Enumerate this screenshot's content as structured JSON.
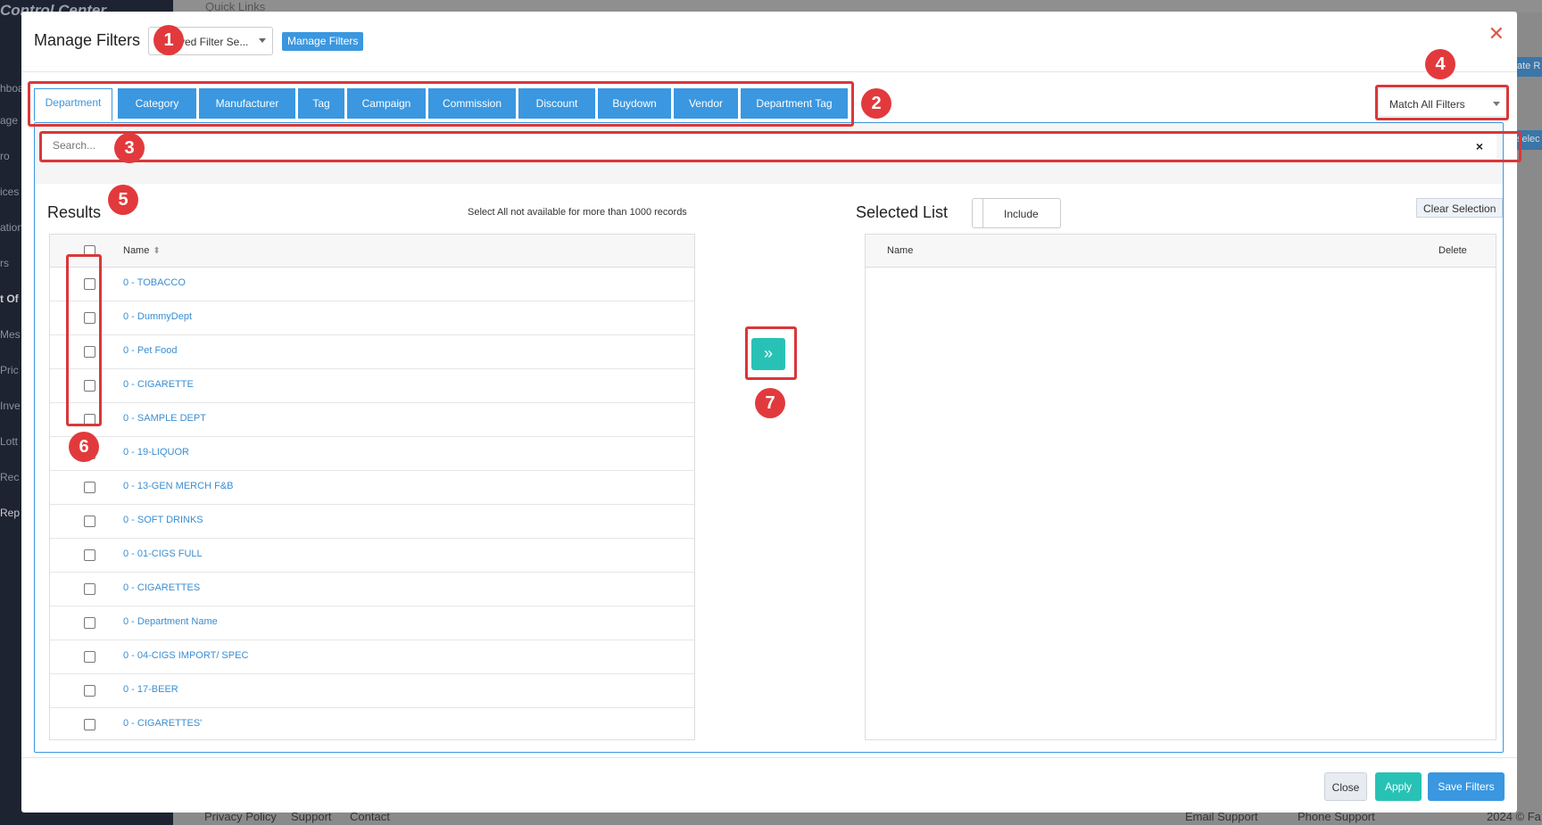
{
  "background": {
    "sidebar_title": "Control Center",
    "sidebar_items": [
      "hboa",
      "age",
      "ro",
      "ices",
      "ation",
      "rs",
      "t Of",
      "Mes",
      "Pric",
      "Inve",
      "Lott",
      "Rec",
      "Rep"
    ],
    "quick_links": "Quick Links",
    "right_buttons": [
      "ate R",
      "selec"
    ],
    "footer_links": [
      "Privacy Policy",
      "Support",
      "Contact"
    ],
    "footer_right": [
      "Email Support",
      "Phone Support",
      "2024 © Fa"
    ]
  },
  "modal": {
    "title": "Manage Filters",
    "saved_filter_select": "ved Filter Se...",
    "manage_filters_button": "Manage Filters",
    "tabs": [
      {
        "label": "Department"
      },
      {
        "label": "Category"
      },
      {
        "label": "Manufacturer"
      },
      {
        "label": "Tag"
      },
      {
        "label": "Campaign"
      },
      {
        "label": "Commission"
      },
      {
        "label": "Discount"
      },
      {
        "label": "Buydown"
      },
      {
        "label": "Vendor"
      },
      {
        "label": "Department Tag"
      }
    ],
    "match_select": "Match All Filters",
    "search": {
      "placeholder": "Search...",
      "clear": "×"
    },
    "results": {
      "title": "Results",
      "note": "Select All not available for more than 1000 records",
      "column_name": "Name",
      "rows": [
        "0 - TOBACCO",
        "0 - DummyDept",
        "0 - Pet Food",
        "0 - CIGARETTE",
        "0 - SAMPLE DEPT",
        "0 - 19-LIQUOR",
        "0 - 13-GEN MERCH F&B",
        "0 - SOFT DRINKS",
        "0 - 01-CIGS FULL",
        "0 - CIGARETTES",
        "0 - Department Name",
        "0 - 04-CIGS IMPORT/ SPEC",
        "0 - 17-BEER",
        "0 - CIGARETTES'"
      ]
    },
    "move_button": "»",
    "selected": {
      "title": "Selected List",
      "include_toggle": "Include",
      "clear_selection": "Clear Selection",
      "column_name": "Name",
      "column_delete": "Delete"
    },
    "footer": {
      "close": "Close",
      "apply": "Apply",
      "save": "Save Filters"
    }
  },
  "annotations": [
    "1",
    "2",
    "3",
    "4",
    "5",
    "6",
    "7"
  ],
  "colors": {
    "primary": "#3a97e0",
    "teal": "#27c2b5",
    "annotation": "#d9373a"
  }
}
